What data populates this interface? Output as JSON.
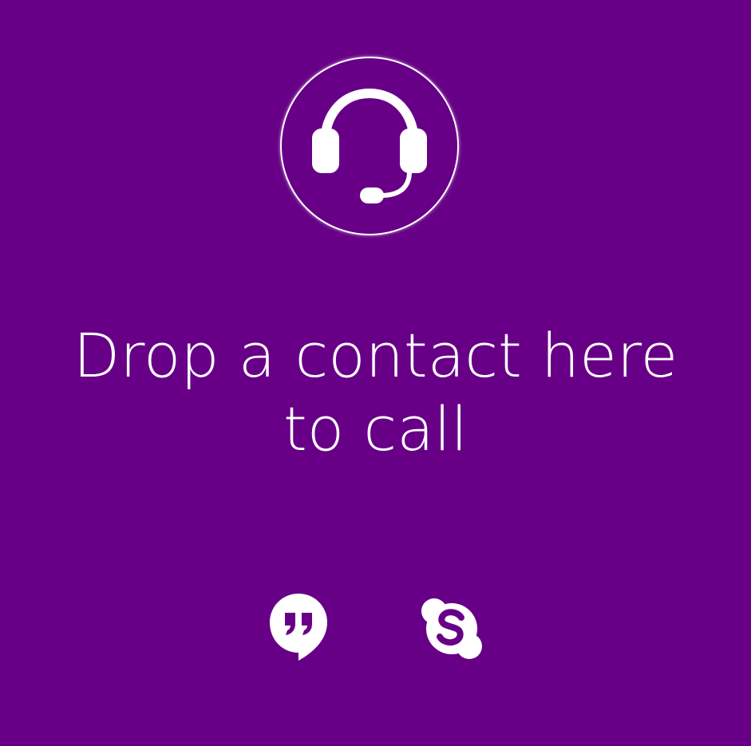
{
  "drop_zone": {
    "message": "Drop a contact here to call",
    "center_icon": "headset-icon"
  },
  "services": [
    {
      "name": "Hangouts",
      "icon": "hangouts-icon"
    },
    {
      "name": "Skype",
      "icon": "skype-icon"
    }
  ],
  "colors": {
    "background": "#670087",
    "foreground": "#ffffff"
  }
}
